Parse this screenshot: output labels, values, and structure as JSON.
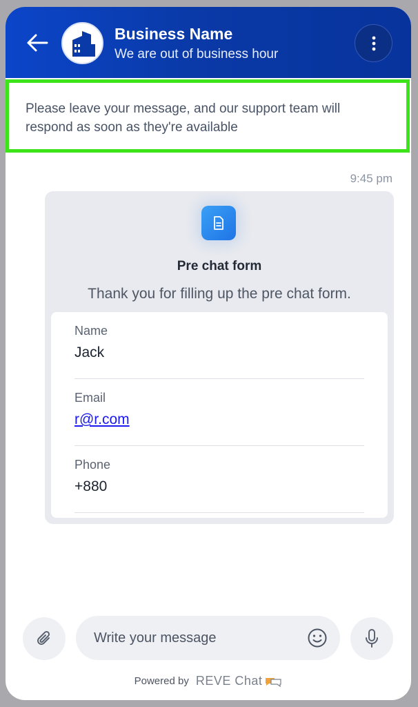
{
  "header": {
    "business_name": "Business Name",
    "status": "We are out of business hour",
    "back_icon": "arrow-left-icon",
    "menu_icon": "more-vertical-icon",
    "logo_icon": "building-icon",
    "color": "#0b45c9"
  },
  "notice": {
    "text": "Please leave your message, and our support team will respond as soon as they're available",
    "highlight_color": "#3ee41a"
  },
  "chat": {
    "timestamp": "9:45 pm",
    "prechat_form": {
      "icon": "document-icon",
      "title": "Pre chat form",
      "subtitle": "Thank you for filling up the pre chat form.",
      "fields": [
        {
          "label": "Name",
          "value": "Jack"
        },
        {
          "label": "Email",
          "value": "r@r.com"
        },
        {
          "label": "Phone",
          "value": "+880"
        }
      ]
    }
  },
  "composer": {
    "placeholder": "Write your message",
    "attach_icon": "paperclip-icon",
    "emoji_icon": "smiley-icon",
    "mic_icon": "microphone-icon"
  },
  "footer": {
    "powered_by": "Powered by",
    "brand": "REVE Chat"
  }
}
